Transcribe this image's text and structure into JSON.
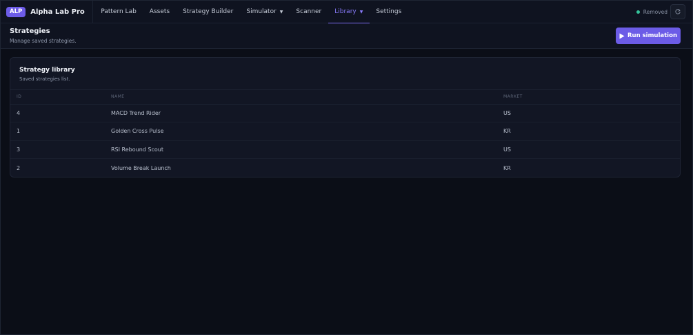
{
  "app": {
    "badge": "ALP",
    "name": "Alpha Lab Pro"
  },
  "nav": {
    "items": [
      {
        "label": "Pattern Lab"
      },
      {
        "label": "Assets"
      },
      {
        "label": "Strategy Builder"
      },
      {
        "label": "Simulator",
        "caret": "▼"
      },
      {
        "label": "Scanner"
      },
      {
        "label": "Library",
        "caret": "▼",
        "active": true
      },
      {
        "label": "Settings"
      }
    ]
  },
  "status": {
    "text": "Removed",
    "color": "#34c39a",
    "refresh_icon": "refresh-icon"
  },
  "page": {
    "title": "Strategies",
    "subtitle": "Manage saved strategies.",
    "run_button": "Run simulation",
    "run_icon": "play-icon"
  },
  "card": {
    "title": "Strategy library",
    "subtitle": "Saved strategies list.",
    "columns": [
      "ID",
      "NAME",
      "MARKET"
    ],
    "rows": [
      {
        "id": "4",
        "name": "MACD Trend Rider",
        "market": "US"
      },
      {
        "id": "1",
        "name": "Golden Cross Pulse",
        "market": "KR"
      },
      {
        "id": "3",
        "name": "RSI Rebound Scout",
        "market": "US"
      },
      {
        "id": "2",
        "name": "Volume Break Launch",
        "market": "KR"
      }
    ]
  },
  "colors": {
    "accent": "#6c5ce7",
    "background": "#0b0e17",
    "surface": "#121624"
  }
}
